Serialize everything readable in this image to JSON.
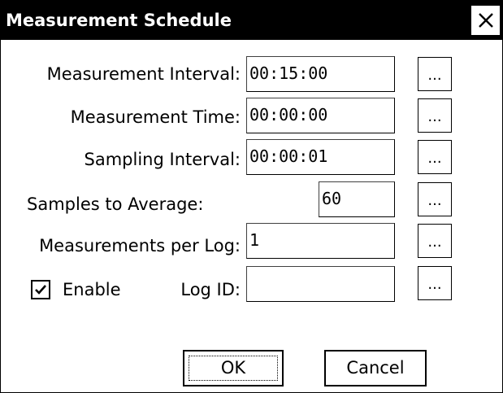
{
  "dialog": {
    "title": "Measurement Schedule",
    "close_icon": "close-icon"
  },
  "fields": {
    "measurement_interval": {
      "label": "Measurement Interval:",
      "value": "00:15:00",
      "button": "..."
    },
    "measurement_time": {
      "label": "Measurement Time:",
      "value": "00:00:00",
      "button": "..."
    },
    "sampling_interval": {
      "label": "Sampling Interval:",
      "value": "00:00:01",
      "button": "..."
    },
    "samples_to_average": {
      "label": "Samples to Average:",
      "value": "60",
      "button": "..."
    },
    "measurements_per_log": {
      "label": "Measurements per Log:",
      "value": "1",
      "button": "..."
    },
    "log_id": {
      "label": "Log ID:",
      "value": "",
      "button": "..."
    }
  },
  "enable": {
    "label": "Enable",
    "checked": true
  },
  "buttons": {
    "ok": "OK",
    "cancel": "Cancel"
  }
}
